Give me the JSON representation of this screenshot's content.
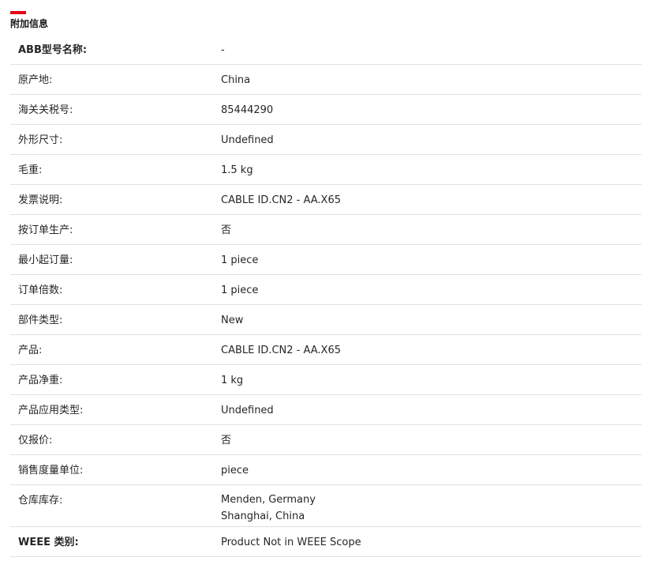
{
  "section": {
    "title": "附加信息",
    "accent_color": "#e60012"
  },
  "rows": [
    {
      "label": "ABB型号名称:",
      "value": "-"
    },
    {
      "label": "原产地:",
      "value": "China"
    },
    {
      "label": "海关关税号:",
      "value": "85444290"
    },
    {
      "label": "外形尺寸:",
      "value": "Undefined"
    },
    {
      "label": "毛重:",
      "value": "1.5 kg"
    },
    {
      "label": "发票说明:",
      "value": "CABLE ID.CN2 - AA.X65"
    },
    {
      "label": "按订单生产:",
      "value": "否"
    },
    {
      "label": "最小起订量:",
      "value": "1 piece"
    },
    {
      "label": "订单倍数:",
      "value": "1 piece"
    },
    {
      "label": "部件类型:",
      "value": "New"
    },
    {
      "label": "产品:",
      "value": "CABLE ID.CN2 - AA.X65"
    },
    {
      "label": "产品净重:",
      "value": "1 kg"
    },
    {
      "label": "产品应用类型:",
      "value": "Undefined"
    },
    {
      "label": "仅报价:",
      "value": "否"
    },
    {
      "label": "销售度量单位:",
      "value": "piece"
    },
    {
      "label": "仓库库存:",
      "values": [
        "Menden, Germany",
        "Shanghai, China"
      ]
    },
    {
      "label": "WEEE 类别:",
      "value": "Product Not in WEEE Scope"
    }
  ]
}
